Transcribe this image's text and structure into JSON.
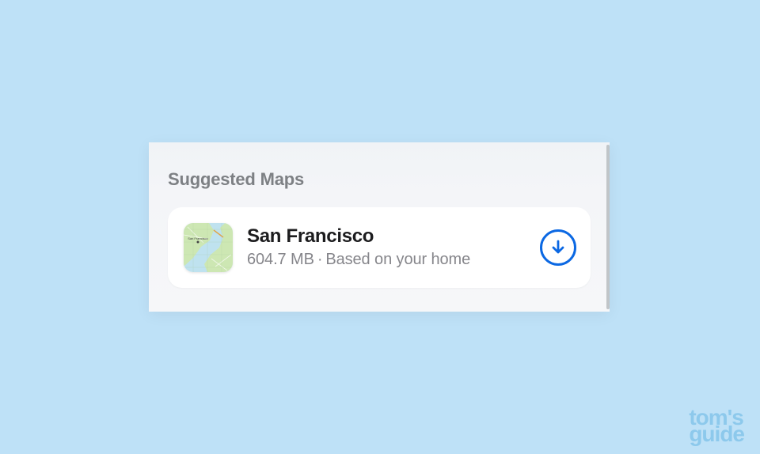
{
  "section": {
    "title": "Suggested Maps"
  },
  "suggestion": {
    "name": "San Francisco",
    "size": "604.7 MB",
    "separator": "·",
    "reason": "Based on your home",
    "thumb_alt": "map-thumbnail-san-francisco"
  },
  "watermark": {
    "line1": "tom's",
    "line2": "guide"
  }
}
